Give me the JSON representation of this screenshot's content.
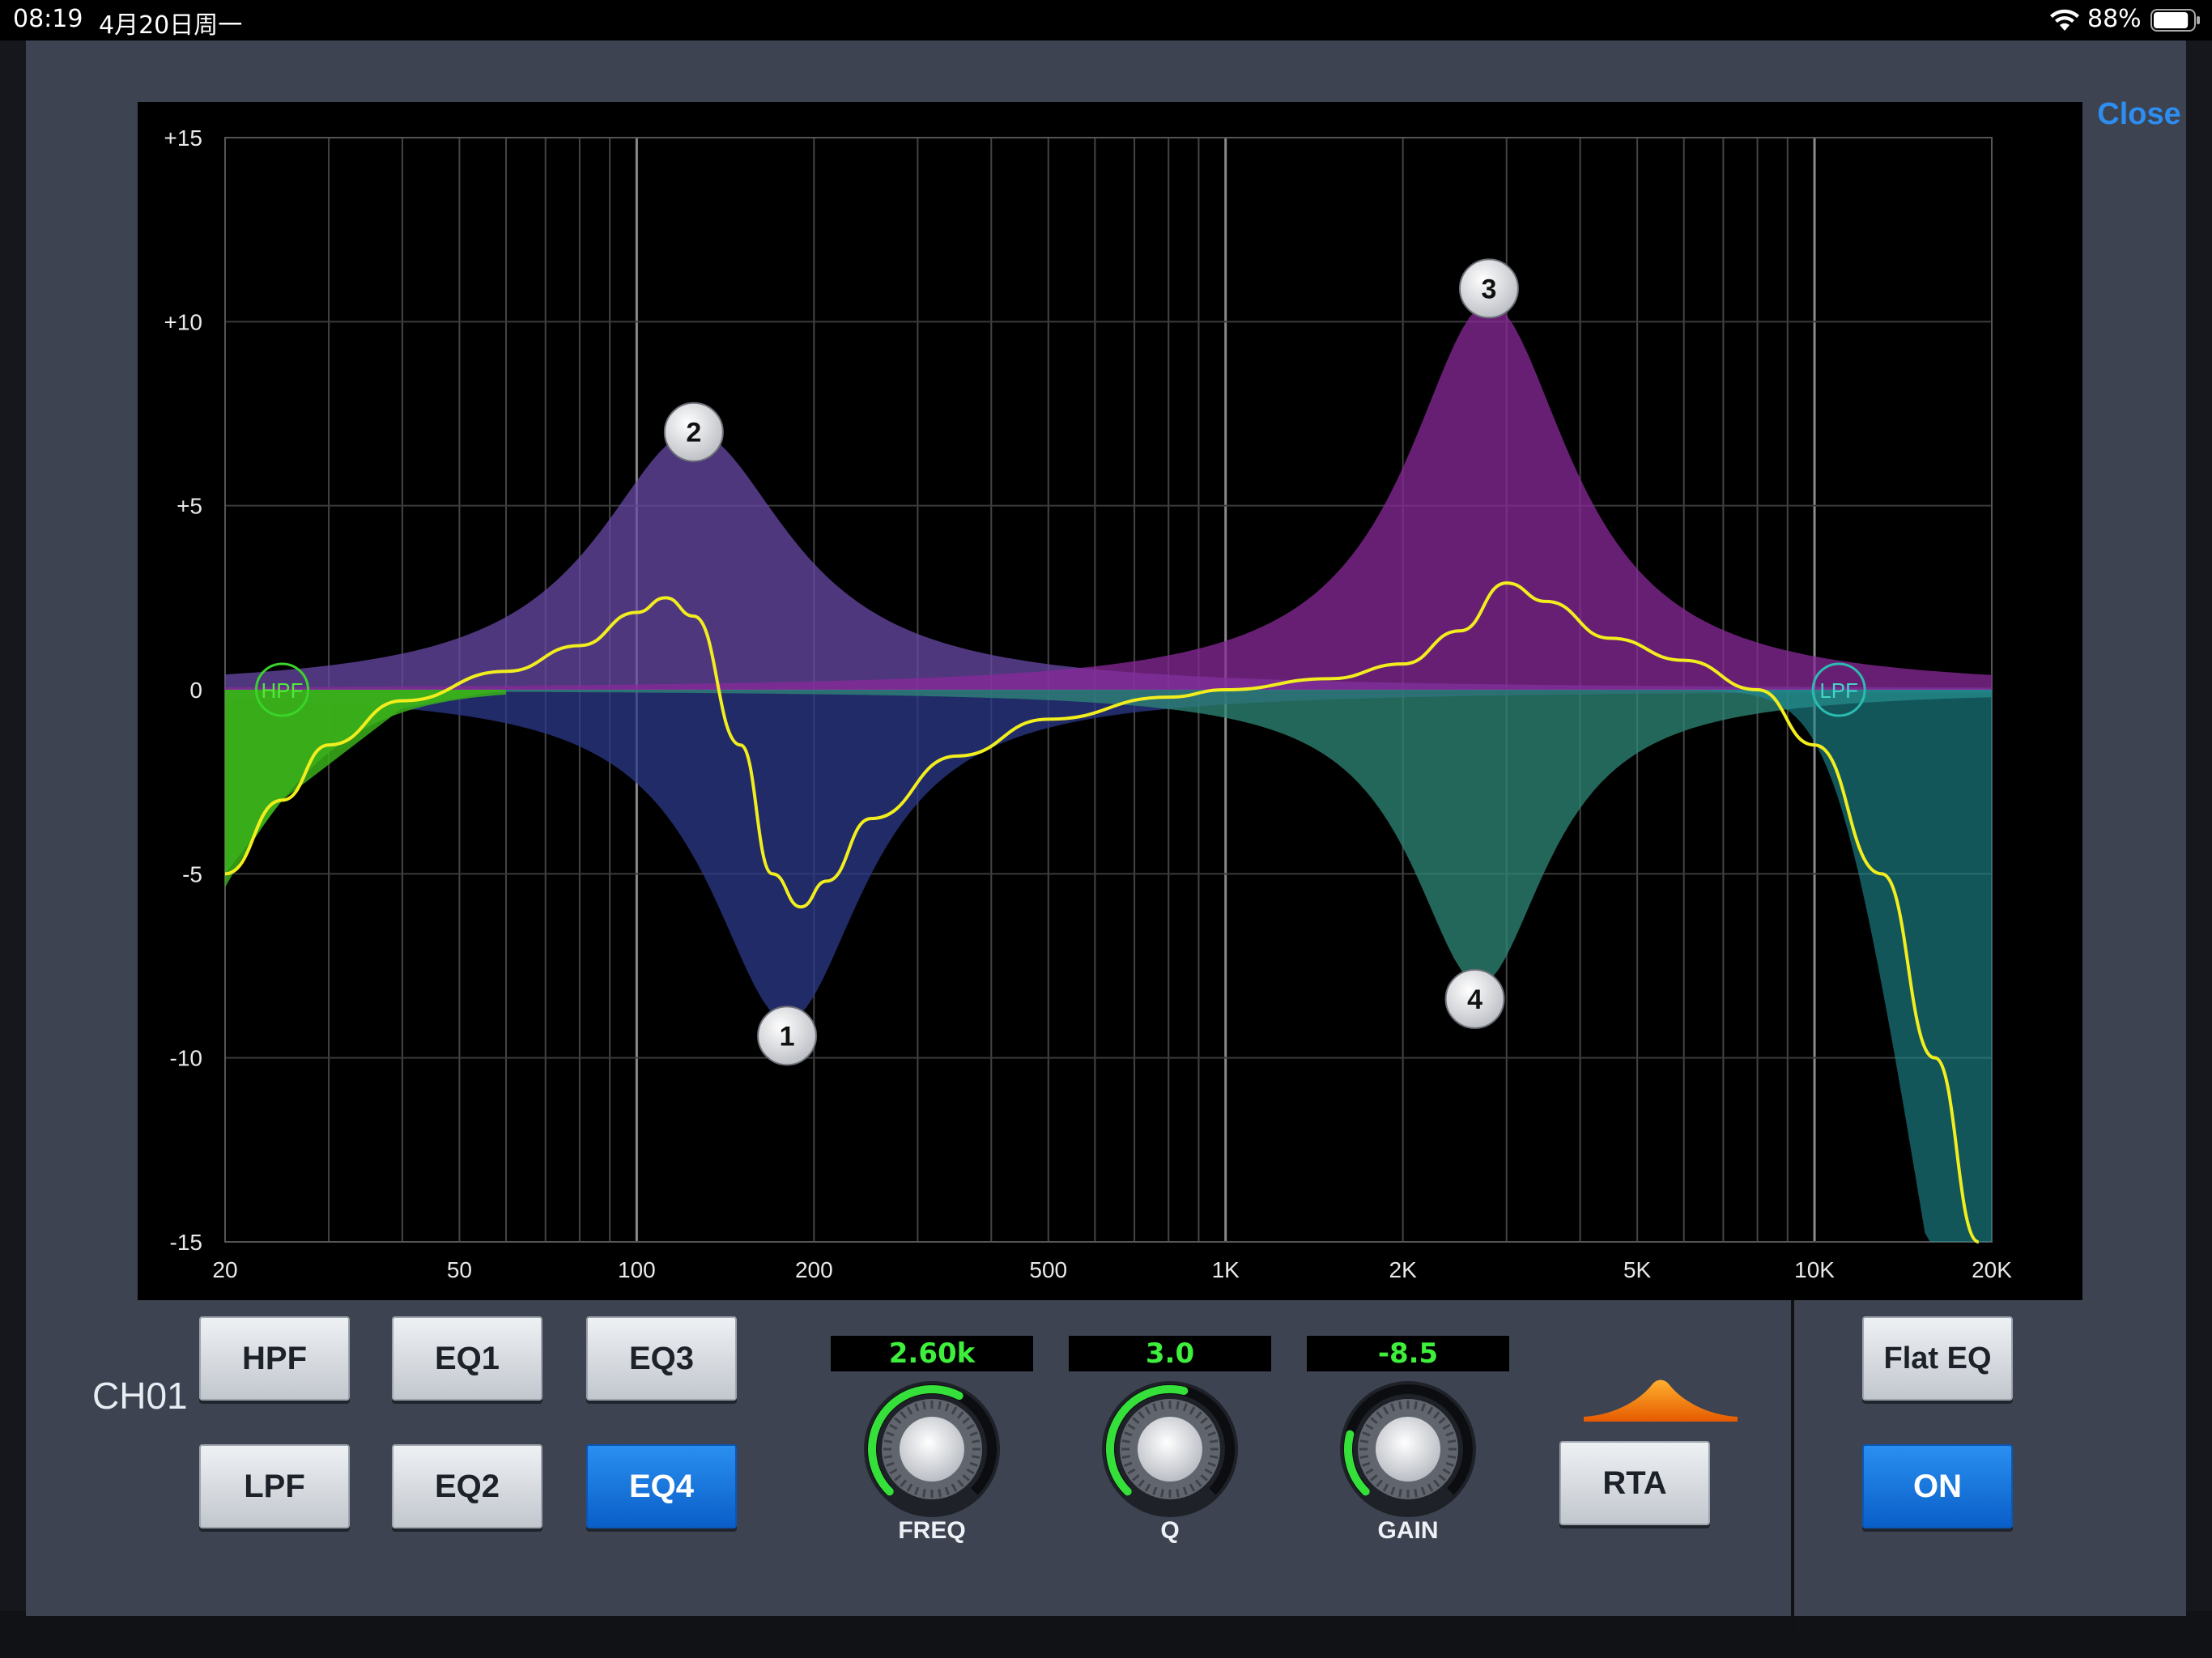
{
  "status_bar": {
    "time": "08:19",
    "date": "4月20日周一",
    "battery_percent": "88%",
    "battery_level": 0.88
  },
  "dialog": {
    "close_label": "Close"
  },
  "eq_graph": {
    "y_ticks": [
      "+15",
      "+10",
      "+5",
      "0",
      "-5",
      "-10",
      "-15"
    ],
    "x_ticks": [
      "20",
      "50",
      "100",
      "200",
      "500",
      "1K",
      "2K",
      "5K",
      "10K",
      "20K"
    ],
    "hpf_label": "HPF",
    "lpf_label": "LPF",
    "band_markers": [
      "1",
      "2",
      "3",
      "4"
    ]
  },
  "chart_data": {
    "type": "line",
    "xscale": "log",
    "xlim": [
      20,
      20000
    ],
    "ylim": [
      -15,
      15
    ],
    "grid": true,
    "bands": [
      {
        "name": "1",
        "freq": 180,
        "gain": -9,
        "color": "#2b3a8a"
      },
      {
        "name": "2",
        "freq": 125,
        "gain": 7,
        "color": "#6a4aa8"
      },
      {
        "name": "3",
        "freq": 2800,
        "gain": 10.5,
        "color": "#8a2a9a"
      },
      {
        "name": "4",
        "freq": 2700,
        "gain": -8,
        "color": "#2f8a78"
      }
    ],
    "hpf": {
      "freq": 25,
      "color": "#3ab01a"
    },
    "lpf": {
      "freq": 11000,
      "color": "#1e8f96"
    },
    "composite_curve": [
      [
        20,
        -5
      ],
      [
        25,
        -3
      ],
      [
        30,
        -1.5
      ],
      [
        40,
        -0.3
      ],
      [
        60,
        0.5
      ],
      [
        80,
        1.2
      ],
      [
        100,
        2.1
      ],
      [
        112,
        2.5
      ],
      [
        125,
        2
      ],
      [
        150,
        -1.5
      ],
      [
        170,
        -5
      ],
      [
        190,
        -5.9
      ],
      [
        210,
        -5.2
      ],
      [
        250,
        -3.5
      ],
      [
        350,
        -1.8
      ],
      [
        500,
        -0.8
      ],
      [
        800,
        -0.2
      ],
      [
        1000,
        0
      ],
      [
        1500,
        0.3
      ],
      [
        2000,
        0.7
      ],
      [
        2500,
        1.6
      ],
      [
        3000,
        2.9
      ],
      [
        3500,
        2.4
      ],
      [
        4500,
        1.4
      ],
      [
        6000,
        0.8
      ],
      [
        8000,
        0
      ],
      [
        10000,
        -1.5
      ],
      [
        13000,
        -5
      ],
      [
        16000,
        -10
      ],
      [
        19000,
        -15
      ]
    ],
    "curve_color": "#f2ee1e"
  },
  "controls": {
    "channel_label": "CH01",
    "band_buttons": {
      "hpf": "HPF",
      "lpf": "LPF",
      "eq1": "EQ1",
      "eq2": "EQ2",
      "eq3": "EQ3",
      "eq4": "EQ4"
    },
    "selected_band": "eq4",
    "freq": {
      "value": "2.60k",
      "label": "FREQ",
      "level": 0.6
    },
    "q": {
      "value": "3.0",
      "label": "Q",
      "level": 0.55
    },
    "gain": {
      "value": "-8.5",
      "label": "GAIN",
      "level": 0.22
    },
    "shape_icon": "peaking-filter-icon",
    "rta_label": "RTA",
    "flat_eq_label": "Flat EQ",
    "on_label": "ON",
    "eq_on": true,
    "accent_color": "#1a78e0"
  }
}
